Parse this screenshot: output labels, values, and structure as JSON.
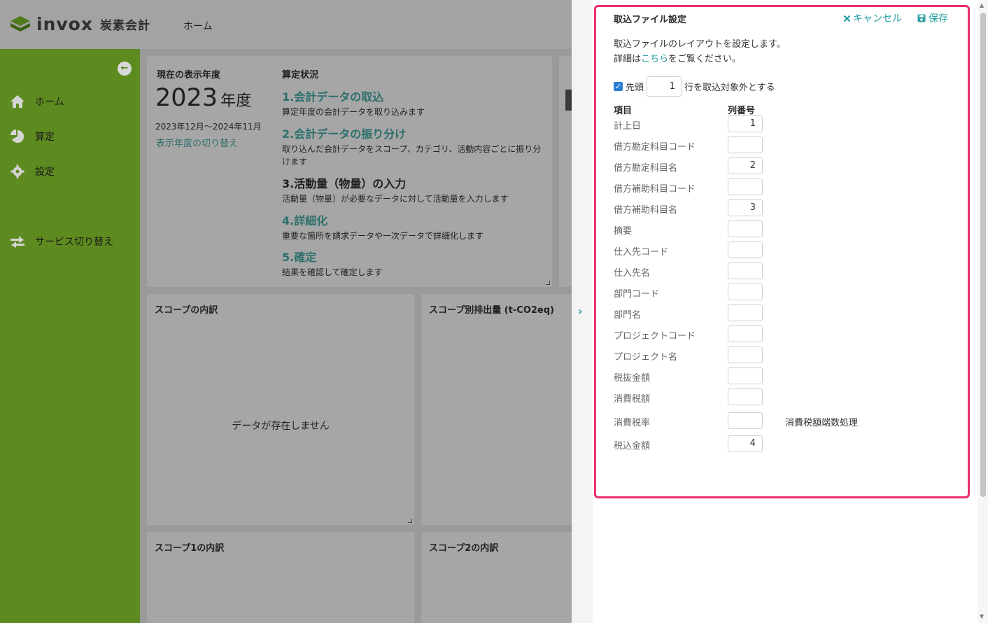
{
  "app": {
    "logo_text": "invox",
    "logo_sub": "炭素会計",
    "top_nav": "ホーム",
    "collapse_glyph": "←",
    "sidebar": [
      {
        "label": "ホーム",
        "icon": "home-icon"
      },
      {
        "label": "算定",
        "icon": "pie-chart-icon"
      },
      {
        "label": "設定",
        "icon": "gear-icon"
      },
      {
        "label": "サービス切り替え",
        "icon": "switch-icon"
      }
    ]
  },
  "dashboard": {
    "year_card": {
      "title": "現在の表示年度",
      "year": "2023",
      "year_suffix": "年度",
      "range": "2023年12月〜2024年11月",
      "switch_link": "表示年度の切り替え"
    },
    "status": {
      "title": "算定状況",
      "steps": [
        {
          "title": "1.会計データの取込",
          "desc": "算定年度の会計データを取り込みます"
        },
        {
          "title": "2.会計データの振り分け",
          "desc": "取り込んだ会計データをスコープ、カテゴリ、活動内容ごとに振り分けます"
        },
        {
          "title": "3.活動量（物量）の入力",
          "desc": "活動量（物量）が必要なデータに対して活動量を入力します"
        },
        {
          "title": "4.詳細化",
          "desc": "重要な箇所を請求データや一次データで詳細化します"
        },
        {
          "title": "5.確定",
          "desc": "結果を確認して確定します"
        }
      ]
    },
    "scope_breakdown": {
      "title": "スコープの内訳",
      "empty": "データが存在しません"
    },
    "scope_emissions": {
      "title": "スコープ別排出量 (t-CO2eq)"
    },
    "scope1": {
      "title": "スコープ1の内訳"
    },
    "scope2": {
      "title": "スコープ2の内訳"
    }
  },
  "drawer": {
    "expand_glyph": "›",
    "title": "取込ファイル設定",
    "cancel_label": "キャンセル",
    "save_label": "保存",
    "desc_line1": "取込ファイルのレイアウトを設定します。",
    "desc_line2_pre": "詳細は",
    "desc_line2_link": "こちら",
    "desc_line2_post": "をご覧ください。",
    "skip": {
      "checked": true,
      "prefix": "先頭",
      "value": "1",
      "suffix": "行を取込対象外とする"
    },
    "col_item": "項目",
    "col_number": "列番号",
    "fields": [
      {
        "label": "計上日",
        "value": "1"
      },
      {
        "label": "借方勘定科目コード",
        "value": ""
      },
      {
        "label": "借方勘定科目名",
        "value": "2"
      },
      {
        "label": "借方補助科目コード",
        "value": ""
      },
      {
        "label": "借方補助科目名",
        "value": "3"
      },
      {
        "label": "摘要",
        "value": ""
      },
      {
        "label": "仕入先コード",
        "value": ""
      },
      {
        "label": "仕入先名",
        "value": ""
      },
      {
        "label": "部門コード",
        "value": ""
      },
      {
        "label": "部門名",
        "value": ""
      },
      {
        "label": "プロジェクトコード",
        "value": ""
      },
      {
        "label": "プロジェクト名",
        "value": ""
      },
      {
        "label": "税抜金額",
        "value": ""
      },
      {
        "label": "消費税額",
        "value": ""
      },
      {
        "label": "消費税率",
        "value": ""
      },
      {
        "label": "税込金額",
        "value": "4"
      }
    ],
    "tax_rounding_label": "消費税額端数処理"
  },
  "colors": {
    "accent": "#27a0a4",
    "sidebar": "#5e8b1f",
    "highlight": "#ea2f6a"
  }
}
